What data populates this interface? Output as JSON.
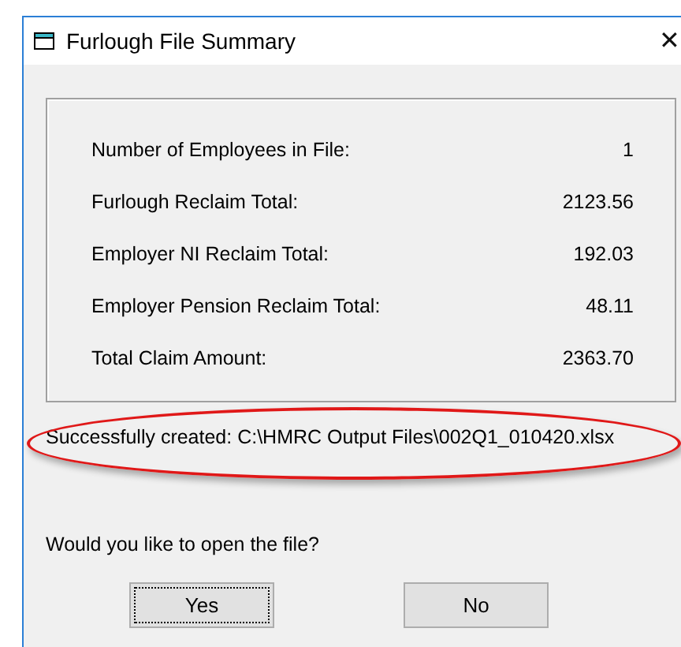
{
  "window": {
    "title": "Furlough File Summary",
    "close": "✕"
  },
  "summary": [
    {
      "label": "Number of Employees in File:",
      "value": "1"
    },
    {
      "label": "Furlough Reclaim Total:",
      "value": "2123.56"
    },
    {
      "label": "Employer NI Reclaim Total:",
      "value": "192.03"
    },
    {
      "label": "Employer Pension Reclaim Total:",
      "value": "48.11"
    },
    {
      "label": "Total Claim Amount:",
      "value": "2363.70"
    }
  ],
  "status": {
    "text": "Successfully created: C:\\HMRC Output Files\\002Q1_010420.xlsx",
    "highlighted": true
  },
  "question": "Would you like to open the file?",
  "buttons": [
    {
      "label": "Yes",
      "focused": true
    },
    {
      "label": "No",
      "focused": false
    }
  ]
}
